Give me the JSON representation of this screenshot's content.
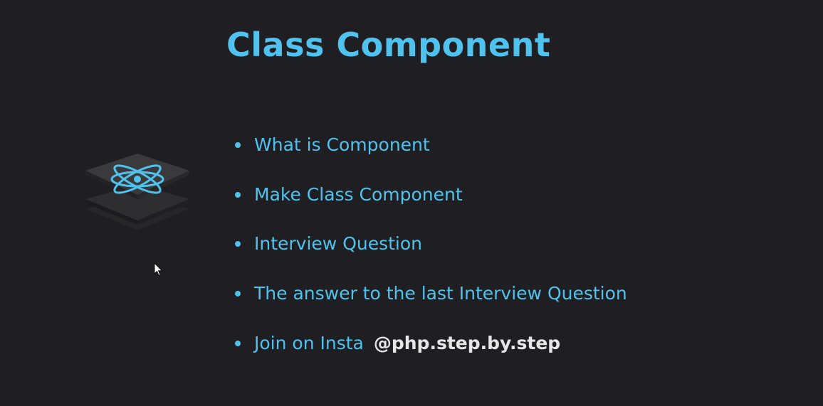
{
  "slide": {
    "title": "Class Component",
    "logo_icon": "react-logo-icon",
    "bullets": [
      {
        "text": "What is Component"
      },
      {
        "text": "Make Class Component"
      },
      {
        "text": "Interview Question"
      },
      {
        "text": "The answer to the last Interview Question"
      },
      {
        "text": "Join on Insta",
        "handle": "@php.step.by.step"
      }
    ]
  },
  "colors": {
    "background": "#1f1f23",
    "accent": "#4fc3ee",
    "handle": "#e6e6e6"
  }
}
